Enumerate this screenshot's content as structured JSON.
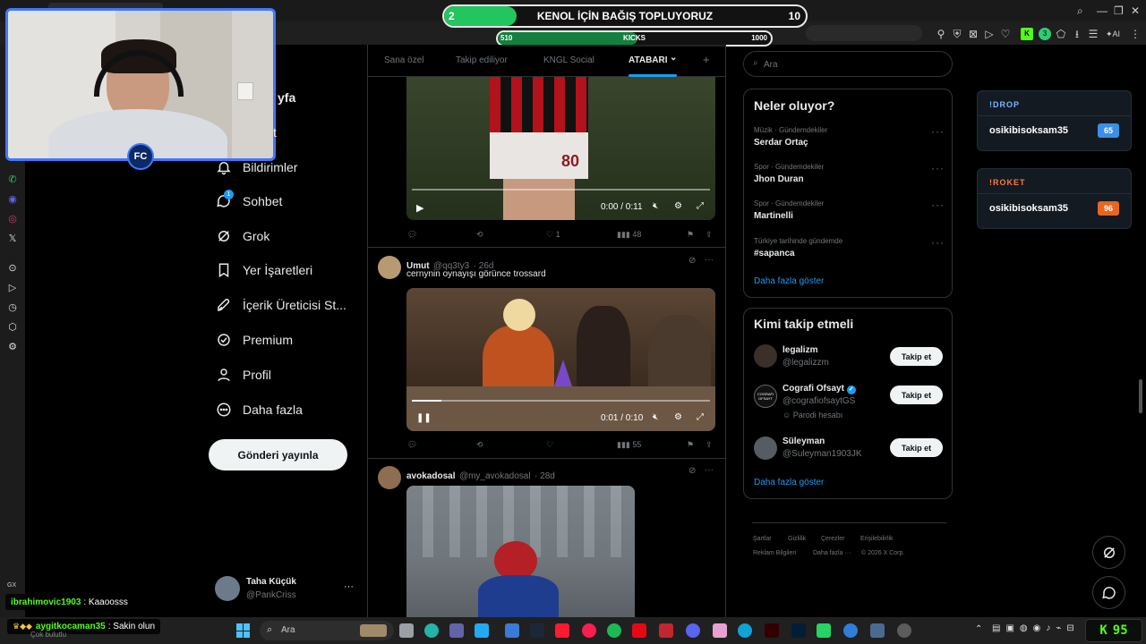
{
  "donation": {
    "left_value": "2",
    "title": "KENOL İÇİN BAĞIŞ TOPLUYORUZ",
    "right_value": "10",
    "progress": 0.2
  },
  "kicks": {
    "left_value": "510",
    "label": "KICKS",
    "right_value": "1000",
    "progress": 0.51
  },
  "nav": {
    "home_partial": "yfa",
    "notifications_partial": "t",
    "items": [
      {
        "label": "Bildirimler",
        "icon": "bell-icon"
      },
      {
        "label": "Sohbet",
        "icon": "chat-icon"
      },
      {
        "label": "Grok",
        "icon": "grok-icon"
      },
      {
        "label": "Yer İşaretleri",
        "icon": "bookmark-icon"
      },
      {
        "label": "İçerik Üreticisi St...",
        "icon": "rocket-icon"
      },
      {
        "label": "Premium",
        "icon": "verified-icon"
      },
      {
        "label": "Profil",
        "icon": "person-icon"
      },
      {
        "label": "Daha fazla",
        "icon": "more-circle-icon"
      }
    ],
    "post_label": "Gönderi yayınla",
    "sohbet_badge": "1"
  },
  "account": {
    "name": "Taha Küçük",
    "handle": "@PankCriss",
    "more": "···"
  },
  "feed": {
    "tabs": [
      {
        "label": "Sana özel",
        "active": false
      },
      {
        "label": "Takip ediliyor",
        "active": false
      },
      {
        "label": "KNGL Social",
        "active": false
      },
      {
        "label": "ATABARI",
        "active": true
      }
    ],
    "tab_chevron": "⌄",
    "plus": "+",
    "video1": {
      "time": "0:00 / 0:11",
      "jersey": "80",
      "likes": "1",
      "views": "48",
      "progress": 0
    },
    "tweet2": {
      "name": "Umut",
      "handle": "@qq3ty3",
      "age": "· 26d",
      "text": "cernynin oynayışı görünce trossard",
      "time": "0:01 / 0:10",
      "views": "55",
      "progress": 0.1
    },
    "tweet3": {
      "name": "avokadosal",
      "handle": "@my_avokadosal",
      "age": "· 28d"
    }
  },
  "search": {
    "placeholder": "Ara"
  },
  "trends": {
    "title": "Neler oluyor?",
    "items": [
      {
        "context": "Müzik · Gündemdekiler",
        "name": "Serdar Ortaç"
      },
      {
        "context": "Spor · Gündemdekiler",
        "name": "Jhon Duran"
      },
      {
        "context": "Spor · Gündemdekiler",
        "name": "Martinelli"
      },
      {
        "context": "Türkiye tarihinde gündemde",
        "name": "#sapanca"
      }
    ],
    "show_more": "Daha fazla göster"
  },
  "who_to_follow": {
    "title": "Kimi takip etmeli",
    "items": [
      {
        "name": "legalizm",
        "handle": "@legalizzm",
        "note": ""
      },
      {
        "name": "Cografi Ofsayt",
        "handle": "@cografiofsaytGS",
        "note": "Parodi hesabı"
      },
      {
        "name": "Süleyman",
        "handle": "@Suleyman1903JK",
        "note": ""
      }
    ],
    "button": "Takip et",
    "show_more": "Daha fazla göster",
    "avatar_text": "COGRAFI OFSAYT"
  },
  "footer": {
    "row1": [
      "Şartlar",
      "Gizlilik",
      "Çerezler",
      "Erişilebilirlik"
    ],
    "row2": [
      "Reklam Bilgileri",
      "Daha fazla ···",
      "© 2026 X Corp."
    ]
  },
  "drops": [
    {
      "title": "!DROP",
      "user": "osikibisoksam35",
      "value": "65",
      "color": "#7bb7ff",
      "badge": "#3b8fe6"
    },
    {
      "title": "!ROKET",
      "user": "osikibisoksam35",
      "value": "96",
      "color": "#ff7a3d",
      "badge": "#e8661f"
    }
  ],
  "webcam": {
    "logo": "FC"
  },
  "chat": {
    "gx": "GX",
    "line1": {
      "user": "ibrahimovic1903",
      "text": ": Kaaoosss"
    },
    "line2": {
      "user": "aygitkocaman35",
      "text": ": Sakin olun"
    },
    "sub": "Çok bulutlu"
  },
  "taskbar": {
    "search": "Ara",
    "counter": "95",
    "counter_letter": "K"
  },
  "colors": {
    "accent": "#1d9bf0",
    "kick_green": "#53fc18",
    "bar_green": "#22c55e"
  }
}
